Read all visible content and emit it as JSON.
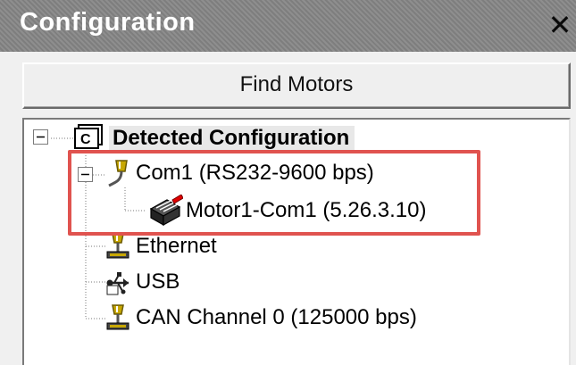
{
  "panel": {
    "title": "Configuration",
    "close_glyph": "✕"
  },
  "toolbar": {
    "find_motors_label": "Find Motors"
  },
  "tree": {
    "root": {
      "label": "Detected Configuration",
      "icon": "configuration-icon",
      "expander": "⊟"
    },
    "com1": {
      "label": "Com1 (RS232-9600 bps)",
      "icon": "serial-connector-icon",
      "expander": "⊟"
    },
    "motor1": {
      "label": "Motor1-Com1 (5.26.3.10)",
      "icon": "motor-icon"
    },
    "ethernet": {
      "label": "Ethernet",
      "icon": "ethernet-connector-icon"
    },
    "usb": {
      "label": "USB",
      "icon": "usb-icon"
    },
    "can": {
      "label": "CAN Channel 0 (125000 bps)",
      "icon": "can-connector-icon"
    }
  },
  "colors": {
    "titlebar": "#858585",
    "highlight_box": "#e0534f",
    "connector_body": "#c8a800",
    "motor_body": "#222222",
    "motor_shaft": "#e00000"
  }
}
